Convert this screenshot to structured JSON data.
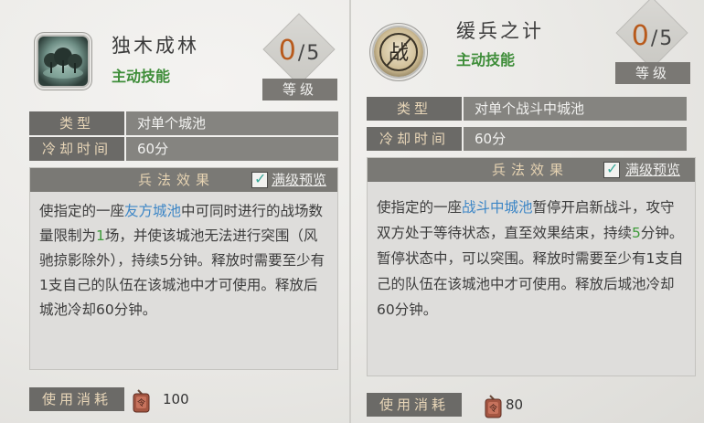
{
  "cards": [
    {
      "skill_name": "独木成林",
      "skill_type": "主动技能",
      "icon": "grove-trees-icon",
      "level": {
        "current": "0",
        "separator": "/",
        "max": "5",
        "label": "等级"
      },
      "rows": [
        {
          "label": "类型",
          "value": "对单个城池"
        },
        {
          "label": "冷却时间",
          "value": "60分"
        }
      ],
      "effect": {
        "title": "兵法效果",
        "preview_label": "满级预览",
        "preview_checked": true,
        "text": [
          {
            "t": "使指定的一座"
          },
          {
            "t": "友方城池",
            "hl": "blue"
          },
          {
            "t": "中可同时进行的战场数量限制为"
          },
          {
            "t": "1",
            "hl": "green"
          },
          {
            "t": "场，并使该城池无法进行突围（风驰掠影除外），持续5分钟。释放时需要至少有1支自己的队伍在该城池中才可使用。释放后城池冷却60分钟。"
          }
        ]
      },
      "cost": {
        "label": "使用消耗",
        "icon": "military-token-icon",
        "value": "100"
      }
    },
    {
      "skill_name": "缓兵之计",
      "skill_type": "主动技能",
      "icon": "battle-seal-icon",
      "icon_glyph": "战",
      "level": {
        "current": "0",
        "separator": "/",
        "max": "5",
        "label": "等级"
      },
      "rows": [
        {
          "label": "类型",
          "value": "对单个战斗中城池"
        },
        {
          "label": "冷却时间",
          "value": "60分"
        }
      ],
      "effect": {
        "title": "兵法效果",
        "preview_label": "满级预览",
        "preview_checked": true,
        "text": [
          {
            "t": "使指定的一座"
          },
          {
            "t": "战斗中城池",
            "hl": "blue"
          },
          {
            "t": "暂停开启新战斗，攻守双方处于等待状态，直至效果结束，持续"
          },
          {
            "t": "5",
            "hl": "green"
          },
          {
            "t": "分钟。暂停状态中，可以突围。释放时需要至少有1支自己的队伍在该城池中才可使用。释放后城池冷却60分钟。"
          }
        ]
      },
      "cost": {
        "label": "使用消耗",
        "icon": "military-token-icon",
        "value": "80"
      }
    }
  ]
}
